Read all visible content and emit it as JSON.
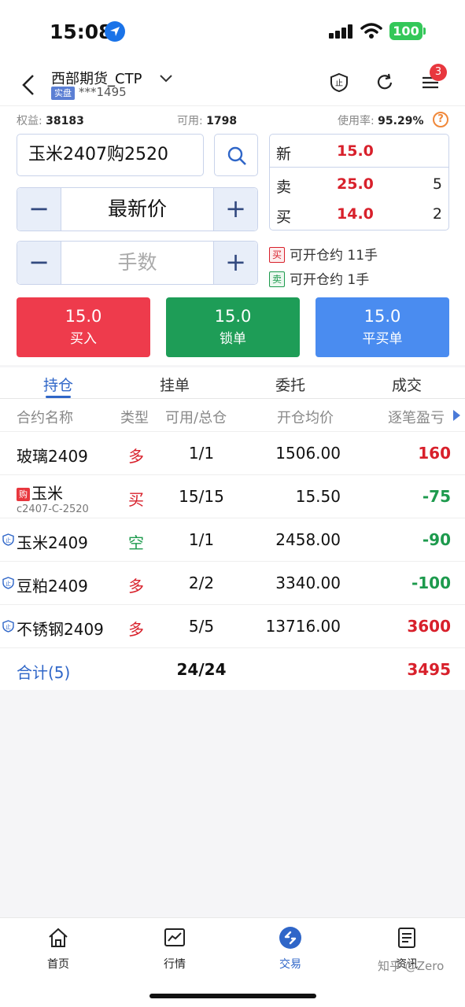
{
  "status": {
    "time": "15:08",
    "battery": "100"
  },
  "header": {
    "account_name": "西部期货_CTP",
    "badge": "实盘",
    "account_no": "***1495",
    "notification_count": "3"
  },
  "stats": {
    "equity_label": "权益:",
    "equity_value": "38183",
    "available_label": "可用:",
    "available_value": "1798",
    "usage_label": "使用率:",
    "usage_value": "95.29%",
    "help": "?"
  },
  "order": {
    "contract": "玉米2407购2520",
    "price_mode": "最新价",
    "qty_placeholder": "手数",
    "minus": "−",
    "plus": "+"
  },
  "quote": {
    "last_label": "新",
    "last_price": "15.0",
    "ask_label": "卖",
    "ask_price": "25.0",
    "ask_vol": "5",
    "bid_label": "买",
    "bid_price": "14.0",
    "bid_vol": "2"
  },
  "openable": {
    "buy_tag": "买",
    "buy_text": "可开仓约",
    "buy_qty": "11手",
    "sell_tag": "卖",
    "sell_text": "可开仓约",
    "sell_qty": "1手"
  },
  "actions": {
    "buy": {
      "price": "15.0",
      "label": "买入"
    },
    "lock": {
      "price": "15.0",
      "label": "锁单"
    },
    "close": {
      "price": "15.0",
      "label": "平买单"
    }
  },
  "tabs": [
    "持仓",
    "挂单",
    "委托",
    "成交"
  ],
  "table": {
    "headers": {
      "name": "合约名称",
      "type": "类型",
      "avail": "可用/总仓",
      "price": "开仓均价",
      "pnl": "逐笔盈亏"
    },
    "rows": [
      {
        "name": "玻璃2409",
        "type": "多",
        "avail": "1/1",
        "price": "1506.00",
        "pnl": "160"
      },
      {
        "name": "玉米",
        "tag": "购",
        "code": "c2407-C-2520",
        "type": "买",
        "avail": "15/15",
        "price": "15.50",
        "pnl": "-75"
      },
      {
        "name": "玉米2409",
        "type": "空",
        "avail": "1/1",
        "price": "2458.00",
        "pnl": "-90"
      },
      {
        "name": "豆粕2409",
        "type": "多",
        "avail": "2/2",
        "price": "3340.00",
        "pnl": "-100"
      },
      {
        "name": "不锈钢2409",
        "type": "多",
        "avail": "5/5",
        "price": "13716.00",
        "pnl": "3600"
      }
    ],
    "total": {
      "label": "合计(5)",
      "avail": "24/24",
      "pnl": "3495"
    }
  },
  "nav": [
    "首页",
    "行情",
    "交易",
    "资讯"
  ],
  "watermark": "知乎 @Zero",
  "colors": {
    "accent": "#2f66c8",
    "up": "#d8202b",
    "down": "#1d9a4d"
  }
}
